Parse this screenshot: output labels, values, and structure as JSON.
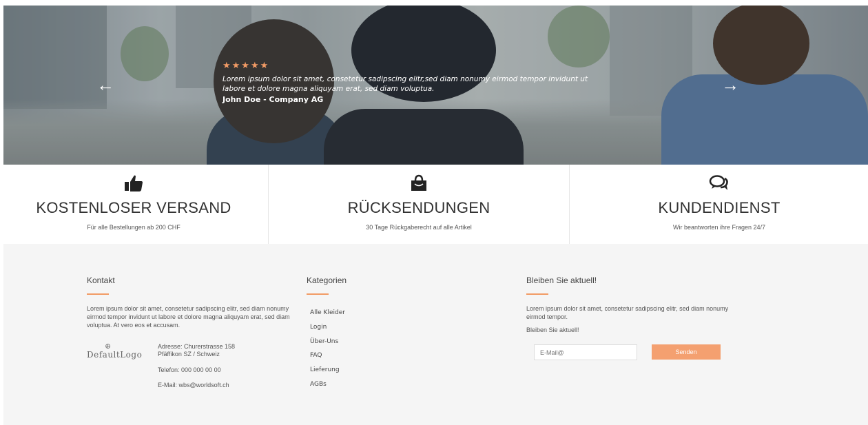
{
  "hero": {
    "stars": "★★★★★",
    "quote": "Lorem ipsum dolor sit amet, consetetur sadipscing elitr,sed diam nonumy eirmod tempor invidunt ut labore et dolore magna aliquyam erat, sed diam voluptua.",
    "author": "John Doe - Company AG",
    "prev_arrow": "←",
    "next_arrow": "→"
  },
  "features": [
    {
      "icon": "thumbs-up-icon",
      "title": "KOSTENLOSER VERSAND",
      "subtitle": "Für alle Bestellungen ab 200 CHF"
    },
    {
      "icon": "shopping-bag-icon",
      "title": "RÜCKSENDUNGEN",
      "subtitle": "30 Tage Rückgaberecht auf alle Artikel"
    },
    {
      "icon": "chat-bubbles-icon",
      "title": "KUNDENDIENST",
      "subtitle": "Wir beantworten ihre Fragen 24/7"
    }
  ],
  "footer": {
    "contact": {
      "heading": "Kontakt",
      "text": "Lorem ipsum dolor sit amet, consetetur sadipscing elitr, sed diam nonumy eirmod tempor invidunt ut labore et dolore magna aliquyam erat, sed diam voluptua. At vero eos et accusam.",
      "logo": "DefaultLogo",
      "address_line1": "Adresse: Churerstrasse 158",
      "address_line2": "Pfäffikon SZ / Schweiz",
      "phone": "Telefon: 000 000 00 00",
      "email": "E-Mail: wbs@worldsoft.ch"
    },
    "categories": {
      "heading": "Kategorien",
      "items": [
        "Alle Kleider",
        "Login",
        "Über-Uns",
        "FAQ",
        "Lieferung",
        "AGBs"
      ]
    },
    "newsletter": {
      "heading": "Bleiben Sie aktuell!",
      "text": "Lorem ipsum dolor sit amet, consetetur sadipscing elitr, sed diam nonumy eirmod tempor.",
      "subtext": "Bleiben Sie aktuell!",
      "email_placeholder": "E-Mail@",
      "button": "Senden"
    }
  },
  "colors": {
    "accent": "#f29b65",
    "button": "#f4a070",
    "footer_bg": "#f5f5f5"
  }
}
